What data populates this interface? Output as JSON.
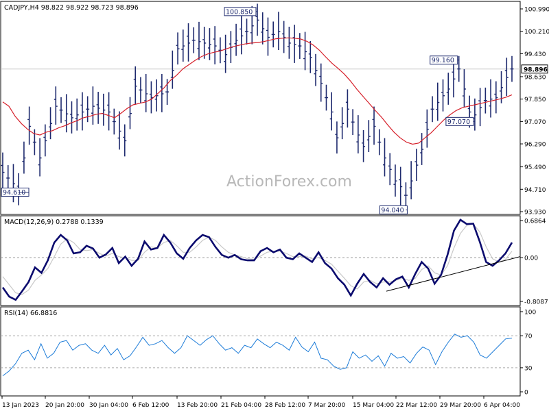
{
  "colors": {
    "price_bars": "#1e2a6e",
    "moving_average": "#d6202a",
    "macd_line": "#0b0b6e",
    "macd_signal": "#c9c9c9",
    "rsi_line": "#1b7bd8",
    "frame": "#000000",
    "grid": "#c8c8c8",
    "watermark": "#b8b8b8"
  },
  "watermark": "ActionForex.com",
  "chart_data": [
    {
      "type": "ohlc",
      "title": "CADJPY,H4  98.822 98.922 98.723 98.896",
      "current_price_label": "98.896",
      "ylim": [
        93.93,
        100.99
      ],
      "y_ticks": [
        "100.990",
        "100.210",
        "99.430",
        "98.630",
        "97.850",
        "97.070",
        "96.290",
        "95.490",
        "94.710",
        "93.930"
      ],
      "y_tick_values": [
        100.99,
        100.21,
        99.43,
        98.63,
        97.85,
        97.07,
        96.29,
        95.49,
        94.71,
        93.93
      ],
      "x_tick_labels": [
        "13 Jan 2023",
        "20 Jan 20:00",
        "30 Jan 04:00",
        "6 Feb 12:00",
        "13 Feb 20:00",
        "21 Feb 04:00",
        "28 Feb 12:00",
        "7 Mar 20:00",
        "15 Mar 04:00",
        "22 Mar 12:00",
        "29 Mar 20:00",
        "6 Apr 04:00"
      ],
      "annotations": [
        {
          "text": "100.850",
          "bar": 48,
          "value": 100.85
        },
        {
          "text": "99.160",
          "bar": 86,
          "value": 99.16
        },
        {
          "text": "97.070",
          "bar": 89,
          "value": 97.07
        },
        {
          "text": "94.610",
          "bar": 3,
          "value": 94.61
        },
        {
          "text": "94.040",
          "bar": 76,
          "value": 94.04
        }
      ],
      "close_anchors": [
        [
          0,
          95.3
        ],
        [
          3,
          94.7
        ],
        [
          5,
          96.9
        ],
        [
          7,
          95.8
        ],
        [
          10,
          97.6
        ],
        [
          13,
          97.2
        ],
        [
          17,
          97.6
        ],
        [
          20,
          97.4
        ],
        [
          23,
          96.4
        ],
        [
          25,
          98.3
        ],
        [
          28,
          97.9
        ],
        [
          31,
          98.1
        ],
        [
          33,
          99.6
        ],
        [
          36,
          99.9
        ],
        [
          40,
          99.7
        ],
        [
          42,
          99.4
        ],
        [
          44,
          99.9
        ],
        [
          46,
          100.2
        ],
        [
          48,
          100.6
        ],
        [
          50,
          100.0
        ],
        [
          52,
          100.2
        ],
        [
          54,
          99.8
        ],
        [
          56,
          99.7
        ],
        [
          58,
          99.3
        ],
        [
          60,
          98.4
        ],
        [
          62,
          97.4
        ],
        [
          63,
          96.5
        ],
        [
          65,
          97.5
        ],
        [
          67,
          96.6
        ],
        [
          68,
          96.2
        ],
        [
          70,
          96.9
        ],
        [
          72,
          95.8
        ],
        [
          74,
          95.0
        ],
        [
          75,
          94.8
        ],
        [
          76,
          94.5
        ],
        [
          77,
          95.0
        ],
        [
          79,
          96.1
        ],
        [
          81,
          97.5
        ],
        [
          84,
          98.2
        ],
        [
          86,
          98.9
        ],
        [
          87,
          98.2
        ],
        [
          88,
          97.4
        ],
        [
          89,
          97.3
        ],
        [
          91,
          97.8
        ],
        [
          93,
          97.9
        ],
        [
          95,
          98.6
        ],
        [
          96,
          98.9
        ]
      ],
      "ma_values": [
        97.75,
        97.6,
        97.25,
        97.0,
        96.8,
        96.65,
        96.6,
        96.7,
        96.75,
        96.85,
        96.92,
        97.02,
        97.1,
        97.2,
        97.25,
        97.32,
        97.35,
        97.28,
        97.2,
        97.35,
        97.52,
        97.65,
        97.7,
        97.75,
        97.85,
        98.05,
        98.25,
        98.5,
        98.68,
        98.9,
        99.05,
        99.2,
        99.33,
        99.42,
        99.48,
        99.52,
        99.6,
        99.67,
        99.72,
        99.77,
        99.8,
        99.82,
        99.85,
        99.9,
        99.95,
        99.97,
        99.98,
        99.97,
        99.94,
        99.86,
        99.73,
        99.55,
        99.32,
        99.1,
        98.92,
        98.72,
        98.48,
        98.2,
        97.95,
        97.7,
        97.45,
        97.22,
        96.95,
        96.7,
        96.5,
        96.35,
        96.28,
        96.32,
        96.5,
        96.68,
        96.9,
        97.12,
        97.3,
        97.45,
        97.55,
        97.6,
        97.65,
        97.7,
        97.75,
        97.8,
        97.85,
        97.91,
        98.0
      ]
    },
    {
      "type": "line",
      "title": "MACD(12,26,9) 0.2788 0.1339",
      "ylim": [
        -0.8087,
        0.6864
      ],
      "y_ticks": [
        "0.6864",
        "0.00",
        "-0.8087"
      ],
      "y_tick_values": [
        0.6864,
        0.0,
        -0.8087
      ],
      "series": [
        {
          "values": [
            -0.55,
            -0.72,
            -0.78,
            -0.62,
            -0.45,
            -0.18,
            -0.28,
            -0.05,
            0.28,
            0.42,
            0.32,
            0.08,
            0.1,
            0.22,
            0.17,
            0.0,
            0.06,
            0.18,
            -0.1,
            0.02,
            -0.15,
            -0.02,
            0.3,
            0.15,
            0.18,
            0.42,
            0.28,
            0.08,
            -0.02,
            0.18,
            0.32,
            0.42,
            0.38,
            0.2,
            0.05,
            0.0,
            0.05,
            -0.03,
            -0.05,
            -0.05,
            0.12,
            0.18,
            0.1,
            0.15,
            0.0,
            -0.03,
            0.08,
            0.0,
            -0.08,
            0.1,
            -0.1,
            -0.2,
            -0.38,
            -0.5,
            -0.7,
            -0.48,
            -0.3,
            -0.45,
            -0.55,
            -0.38,
            -0.5,
            -0.4,
            -0.35,
            -0.55,
            -0.3,
            -0.08,
            -0.2,
            -0.48,
            -0.32,
            0.05,
            0.5,
            0.7,
            0.62,
            0.63,
            0.3,
            -0.08,
            -0.15,
            -0.05,
            0.08,
            0.28
          ]
        },
        {
          "values": [
            -0.35,
            -0.5,
            -0.65,
            -0.68,
            -0.6,
            -0.42,
            -0.32,
            -0.2,
            0.02,
            0.25,
            0.35,
            0.28,
            0.15,
            0.13,
            0.15,
            0.08,
            0.03,
            0.08,
            0.02,
            0.0,
            -0.05,
            -0.05,
            0.1,
            0.2,
            0.18,
            0.28,
            0.32,
            0.22,
            0.1,
            0.1,
            0.2,
            0.32,
            0.38,
            0.32,
            0.2,
            0.1,
            0.05,
            0.02,
            -0.02,
            -0.03,
            0.03,
            0.1,
            0.12,
            0.12,
            0.08,
            0.02,
            0.02,
            0.03,
            -0.02,
            0.0,
            -0.05,
            -0.12,
            -0.25,
            -0.38,
            -0.52,
            -0.58,
            -0.45,
            -0.42,
            -0.48,
            -0.45,
            -0.45,
            -0.42,
            -0.38,
            -0.42,
            -0.38,
            -0.22,
            -0.15,
            -0.28,
            -0.32,
            -0.15,
            0.18,
            0.45,
            0.6,
            0.62,
            0.48,
            0.2,
            -0.02,
            -0.08,
            -0.03,
            0.12
          ]
        }
      ],
      "trendline": [
        [
          -0.62,
          0.0
        ],
        [
          0.02,
          1.0
        ]
      ]
    },
    {
      "type": "line",
      "title": "RSI(14) 66.8816",
      "ylim": [
        0,
        100
      ],
      "y_ticks": [
        "100",
        "70",
        "30",
        "0"
      ],
      "y_tick_values": [
        100,
        70,
        30,
        0
      ],
      "series": [
        {
          "values": [
            20,
            26,
            35,
            48,
            52,
            40,
            60,
            42,
            48,
            62,
            64,
            52,
            58,
            60,
            52,
            48,
            58,
            46,
            54,
            40,
            45,
            56,
            68,
            58,
            60,
            64,
            55,
            48,
            55,
            70,
            64,
            58,
            65,
            70,
            60,
            52,
            55,
            48,
            58,
            55,
            66,
            60,
            55,
            62,
            58,
            52,
            68,
            56,
            50,
            62,
            42,
            40,
            32,
            28,
            30,
            50,
            42,
            46,
            38,
            45,
            32,
            48,
            42,
            44,
            36,
            48,
            56,
            52,
            34,
            50,
            62,
            72,
            68,
            70,
            62,
            46,
            42,
            50,
            58,
            66,
            67
          ]
        }
      ]
    }
  ]
}
